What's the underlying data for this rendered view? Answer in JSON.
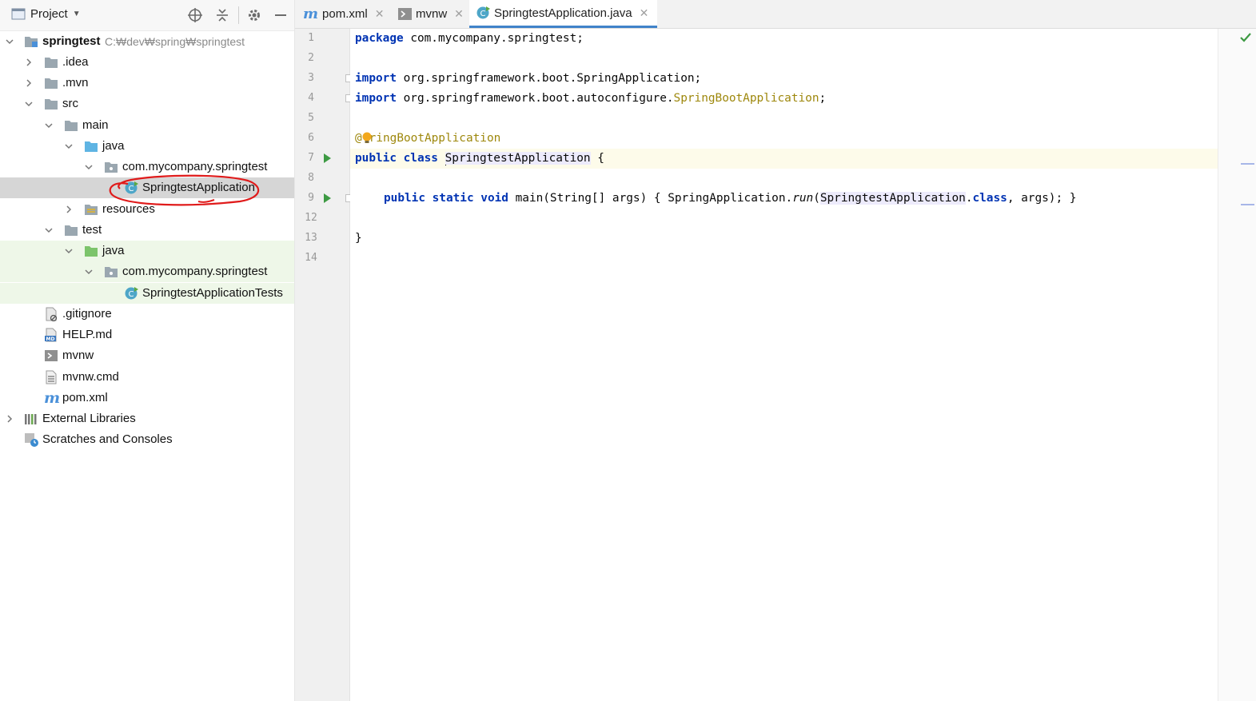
{
  "project_panel": {
    "title": "Project",
    "toolbar_icons": [
      "locate-icon",
      "collapse-all-icon",
      "gear-icon",
      "minimize-icon"
    ]
  },
  "tree": {
    "root": {
      "name": "springtest",
      "path": "C:₩dev₩spring₩springtest"
    },
    "items": [
      {
        "label": ".idea"
      },
      {
        "label": ".mvn"
      },
      {
        "label": "src"
      },
      {
        "label": "main"
      },
      {
        "label": "java"
      },
      {
        "label": "com.mycompany.springtest"
      },
      {
        "label": "SpringtestApplication"
      },
      {
        "label": "resources"
      },
      {
        "label": "test"
      },
      {
        "label": "java"
      },
      {
        "label": "com.mycompany.springtest"
      },
      {
        "label": "SpringtestApplicationTests"
      },
      {
        "label": ".gitignore"
      },
      {
        "label": "HELP.md"
      },
      {
        "label": "mvnw"
      },
      {
        "label": "mvnw.cmd"
      },
      {
        "label": "pom.xml"
      },
      {
        "label": "External Libraries"
      },
      {
        "label": "Scratches and Consoles"
      }
    ]
  },
  "tabs": [
    {
      "label": "pom.xml",
      "icon": "maven-icon"
    },
    {
      "label": "mvnw",
      "icon": "terminal-icon"
    },
    {
      "label": "SpringtestApplication.java",
      "icon": "spring-class-icon",
      "active": true
    }
  ],
  "editor": {
    "line_numbers": [
      "1",
      "2",
      "3",
      "4",
      "5",
      "6",
      "7",
      "8",
      "9",
      "12",
      "13",
      "14"
    ],
    "lines": {
      "l1_kw": "package",
      "l1_rest": " com.mycompany.springtest;",
      "l3_kw": "import",
      "l3_rest": " org.springframework.boot.SpringApplication;",
      "l4_kw": "import",
      "l4_rest": " org.springframework.boot.autoconfigure.",
      "l4_ann": "SpringBootApplication",
      "l4_end": ";",
      "l6_ann_a": "@",
      "l6_ann_b": "ringBootApplication",
      "l7_kw": "public class",
      "l7_cls": "SpringtestApplication",
      "l7_rest": " {",
      "l9_kw": "public static void",
      "l9_a": " main(String[] args) { SpringApplication.",
      "l9_run": "run",
      "l9_b": "(",
      "l9_cls": "SpringtestApplication",
      "l9_c": ".",
      "l9_kw2": "class",
      "l9_d": ", args); }",
      "l13": "}"
    }
  },
  "colors": {
    "keyword": "#0033b3",
    "annotation": "#9e880d",
    "selection": "#d6d6d6",
    "test_background": "#eef7e8",
    "annotation_circle": "#e01b1b"
  }
}
